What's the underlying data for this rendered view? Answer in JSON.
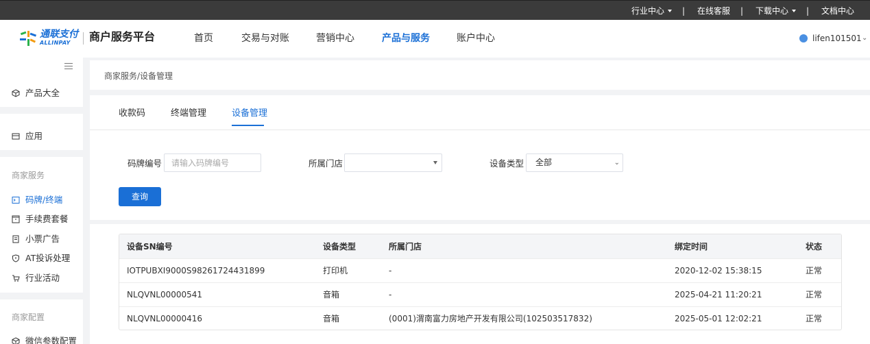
{
  "topbar": {
    "items": [
      {
        "label": "行业中心",
        "dropdown": true
      },
      {
        "label": "在线客服",
        "dropdown": false
      },
      {
        "label": "下载中心",
        "dropdown": true
      },
      {
        "label": "文档中心",
        "dropdown": false
      }
    ],
    "separator": "|"
  },
  "header": {
    "logo_cn": "通联支付",
    "logo_en": "ALLINPAY",
    "platform": "商户服务平台",
    "nav": [
      {
        "label": "首页",
        "active": false
      },
      {
        "label": "交易与对账",
        "active": false
      },
      {
        "label": "营销中心",
        "active": false
      },
      {
        "label": "产品与服务",
        "active": true
      },
      {
        "label": "账户中心",
        "active": false
      }
    ],
    "username": "lifen101501"
  },
  "sidebar": {
    "top_items": [
      {
        "label": "产品大全",
        "icon": "cube-icon"
      },
      {
        "label": "应用",
        "icon": "app-icon"
      }
    ],
    "section1_title": "商家服务",
    "section1_items": [
      {
        "label": "码牌/终端",
        "icon": "terminal-icon",
        "active": true
      },
      {
        "label": "手续费套餐",
        "icon": "package-icon",
        "active": false
      },
      {
        "label": "小票广告",
        "icon": "receipt-icon",
        "active": false
      },
      {
        "label": "AT投诉处理",
        "icon": "shield-icon",
        "active": false
      },
      {
        "label": "行业活动",
        "icon": "cart-icon",
        "active": false
      }
    ],
    "section2_title": "商家配置",
    "section2_items": [
      {
        "label": "微信参数配置",
        "icon": "cube-icon"
      }
    ]
  },
  "breadcrumb": "商家服务/设备管理",
  "tabs": [
    {
      "label": "收款码",
      "active": false
    },
    {
      "label": "终端管理",
      "active": false
    },
    {
      "label": "设备管理",
      "active": true
    }
  ],
  "filters": {
    "code_label": "码牌编号",
    "code_placeholder": "请输入码牌编号",
    "code_value": "",
    "store_label": "所属门店",
    "store_value": "",
    "type_label": "设备类型",
    "type_value": "全部",
    "query_button": "查询"
  },
  "table": {
    "columns": [
      "设备SN编号",
      "设备类型",
      "所属门店",
      "绑定时间",
      "状态"
    ],
    "rows": [
      [
        "IOTPUBXI9000S98261724431899",
        "打印机",
        "-",
        "2020-12-02 15:38:15",
        "正常"
      ],
      [
        "NLQVNL00000541",
        "音箱",
        "-",
        "2025-04-21 11:20:21",
        "正常"
      ],
      [
        "NLQVNL00000416",
        "音箱",
        "(0001)渭南富力房地产开发有限公司(102503517832)",
        "2025-05-01 12:02:21",
        "正常"
      ]
    ]
  },
  "colors": {
    "accent": "#1a6fd6",
    "topbar_bg": "#3b3b3b",
    "page_bg": "#f2f3f5"
  }
}
